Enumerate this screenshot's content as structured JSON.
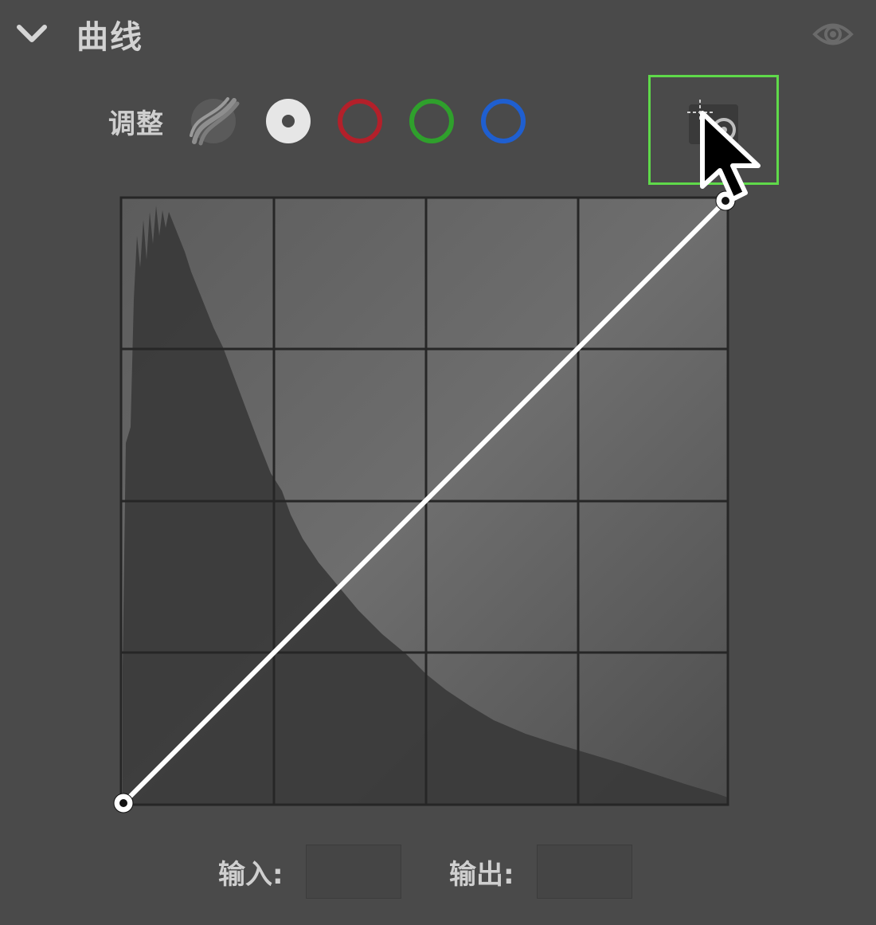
{
  "panel": {
    "title": "曲线"
  },
  "toolbar": {
    "adjust_label": "调整",
    "channels": [
      "parametric",
      "rgb",
      "red",
      "green",
      "blue"
    ],
    "selected_channel": "rgb"
  },
  "colors": {
    "background": "#4a4a4a",
    "highlight": "#5fd94a",
    "red": "#b3202a",
    "green": "#2fa02c",
    "blue": "#1f5fd0"
  },
  "curve": {
    "points": [
      [
        0,
        0
      ],
      [
        255,
        255
      ]
    ]
  },
  "io": {
    "input_label": "输入:",
    "output_label": "输出:",
    "input_value": "",
    "output_value": ""
  }
}
